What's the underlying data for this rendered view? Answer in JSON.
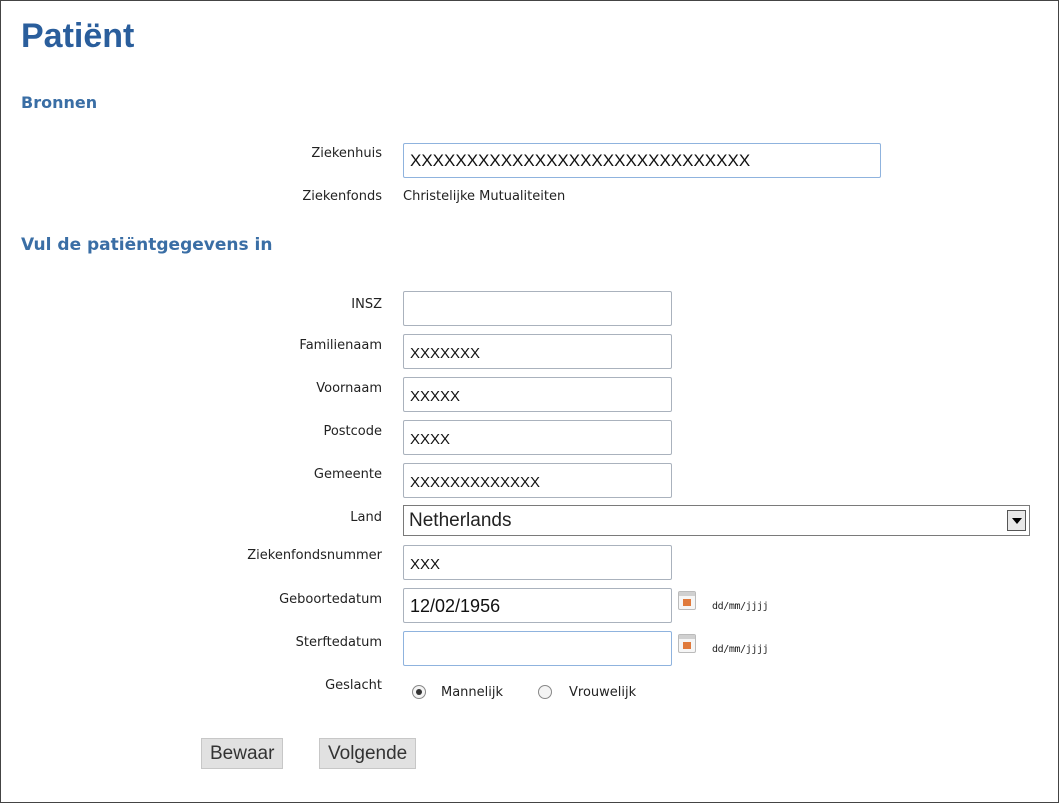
{
  "page": {
    "title": "Patiënt"
  },
  "sections": {
    "sources": "Bronnen",
    "patient": "Vul de patiëntgegevens in"
  },
  "sources": {
    "hospital_label": "Ziekenhuis",
    "hospital_value": "XXXXXXXXXXXXXXXXXXXXXXXXXXXXXX",
    "fund_label": "Ziekenfonds",
    "fund_value": "Christelijke Mutualiteiten"
  },
  "fields": {
    "insz": {
      "label": "INSZ",
      "value": ""
    },
    "family_name": {
      "label": "Familienaam",
      "value": "XXXXXXX"
    },
    "first_name": {
      "label": "Voornaam",
      "value": "XXXXX"
    },
    "postcode": {
      "label": "Postcode",
      "value": "XXXX"
    },
    "municipality": {
      "label": "Gemeente",
      "value": "XXXXXXXXXXXXX"
    },
    "country": {
      "label": "Land",
      "value": "Netherlands"
    },
    "fund_number": {
      "label": "Ziekenfondsnummer",
      "value": "XXX"
    },
    "birth_date": {
      "label": "Geboortedatum",
      "value": "12/02/1956",
      "hint": "dd/mm/jjjj"
    },
    "death_date": {
      "label": "Sterftedatum",
      "value": "",
      "hint": "dd/mm/jjjj"
    },
    "gender": {
      "label": "Geslacht",
      "options": [
        "Mannelijk",
        "Vrouwelijk"
      ],
      "selected": "Mannelijk"
    }
  },
  "buttons": {
    "save": "Bewaar",
    "next": "Volgende"
  },
  "icons": {
    "calendar": "calendar-icon",
    "dropdown": "chevron-down-icon",
    "radio": "radio-icon"
  },
  "colors": {
    "title": "#2a5e9c",
    "section": "#3a6ea5"
  }
}
